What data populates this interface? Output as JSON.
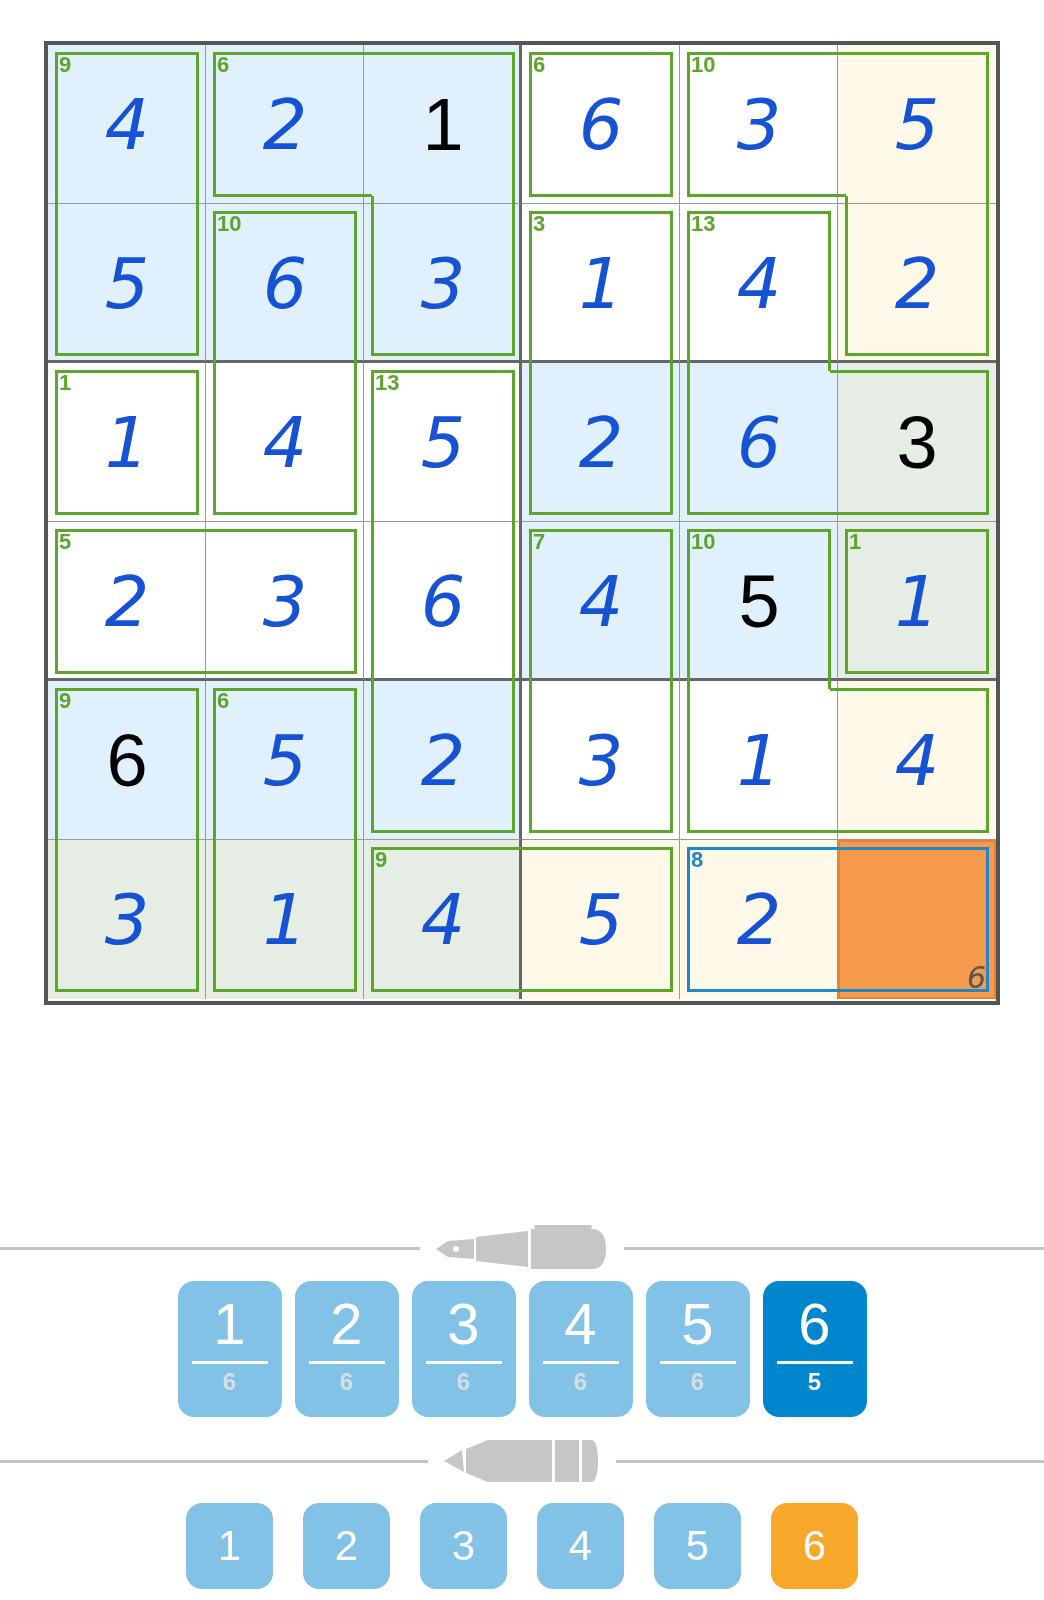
{
  "grid": {
    "rows": [
      [
        {
          "value": "4",
          "given": false,
          "color": "#e0f0fc",
          "sum": "9",
          "kind": "top",
          "selected": false,
          "cage_active": false
        },
        {
          "value": "2",
          "given": false,
          "color": "#e0f0fc",
          "sum": "6",
          "kind": "left",
          "selected": false,
          "cage_active": false
        },
        {
          "value": "1",
          "given": true,
          "color": "#e0f0fc",
          "kind": "topright",
          "selected": false,
          "cage_active": false
        },
        {
          "value": "6",
          "given": false,
          "color": "#ffffff",
          "sum": "6",
          "kind": "single",
          "selected": false,
          "cage_active": false
        },
        {
          "value": "3",
          "given": false,
          "color": "#ffffff",
          "sum": "10",
          "kind": "left",
          "selected": false,
          "cage_active": false
        },
        {
          "value": "5",
          "given": false,
          "color": "#fdf8e7",
          "kind": "topright",
          "selected": false,
          "cage_active": false
        }
      ],
      [
        {
          "value": "5",
          "given": false,
          "color": "#e0f0fc",
          "kind": "bottom",
          "selected": false,
          "cage_active": false
        },
        {
          "value": "6",
          "given": false,
          "color": "#e0f0fc",
          "sum": "10",
          "kind": "top",
          "selected": false,
          "cage_active": false
        },
        {
          "value": "3",
          "given": false,
          "color": "#e0f0fc",
          "kind": "bottom",
          "selected": false,
          "cage_active": false
        },
        {
          "value": "1",
          "given": false,
          "color": "#ffffff",
          "sum": "3",
          "kind": "top",
          "selected": false,
          "cage_active": false
        },
        {
          "value": "4",
          "given": false,
          "color": "#ffffff",
          "sum": "13",
          "kind": "top",
          "selected": false,
          "cage_active": false
        },
        {
          "value": "2",
          "given": false,
          "color": "#fdf8e7",
          "kind": "bottom",
          "selected": false,
          "cage_active": false
        }
      ],
      [
        {
          "value": "1",
          "given": false,
          "color": "#ffffff",
          "sum": "1",
          "kind": "single",
          "selected": false,
          "cage_active": false
        },
        {
          "value": "4",
          "given": false,
          "color": "#ffffff",
          "kind": "bottom",
          "selected": false,
          "cage_active": false
        },
        {
          "value": "5",
          "given": false,
          "color": "#ffffff",
          "sum": "13",
          "kind": "top",
          "selected": false,
          "cage_active": false
        },
        {
          "value": "2",
          "given": false,
          "color": "#e0f0fc",
          "kind": "bottom",
          "selected": false,
          "cage_active": false
        },
        {
          "value": "6",
          "given": false,
          "color": "#e0f0fc",
          "kind": "bottomleft",
          "selected": false,
          "cage_active": false
        },
        {
          "value": "3",
          "given": true,
          "color": "#e6ede4",
          "kind": "right",
          "selected": false,
          "cage_active": false
        }
      ],
      [
        {
          "value": "2",
          "given": false,
          "color": "#ffffff",
          "sum": "5",
          "kind": "left",
          "selected": false,
          "cage_active": false
        },
        {
          "value": "3",
          "given": false,
          "color": "#ffffff",
          "kind": "right",
          "selected": false,
          "cage_active": false
        },
        {
          "value": "6",
          "given": false,
          "color": "#ffffff",
          "kind": "middle",
          "selected": false,
          "cage_active": false
        },
        {
          "value": "4",
          "given": false,
          "color": "#e0f0fc",
          "sum": "7",
          "kind": "top",
          "selected": false,
          "cage_active": false
        },
        {
          "value": "5",
          "given": true,
          "color": "#e0f0fc",
          "sum": "10",
          "kind": "top",
          "selected": false,
          "cage_active": false
        },
        {
          "value": "1",
          "given": false,
          "color": "#e6ede4",
          "sum": "1",
          "kind": "single",
          "selected": false,
          "cage_active": false
        }
      ],
      [
        {
          "value": "6",
          "given": true,
          "color": "#e0f0fc",
          "sum": "9",
          "kind": "top",
          "selected": false,
          "cage_active": false
        },
        {
          "value": "5",
          "given": false,
          "color": "#e0f0fc",
          "sum": "6",
          "kind": "top",
          "selected": false,
          "cage_active": false
        },
        {
          "value": "2",
          "given": false,
          "color": "#e0f0fc",
          "kind": "bottom",
          "selected": false,
          "cage_active": false
        },
        {
          "value": "3",
          "given": false,
          "color": "#ffffff",
          "kind": "bottom",
          "selected": false,
          "cage_active": false
        },
        {
          "value": "1",
          "given": false,
          "color": "#ffffff",
          "kind": "bottomleft",
          "selected": false,
          "cage_active": false
        },
        {
          "value": "4",
          "given": false,
          "color": "#fdf8e7",
          "kind": "right",
          "selected": false,
          "cage_active": false
        }
      ],
      [
        {
          "value": "3",
          "given": false,
          "color": "#e6ede4",
          "kind": "bottom",
          "selected": false,
          "cage_active": false
        },
        {
          "value": "1",
          "given": false,
          "color": "#e6ede4",
          "kind": "bottom",
          "selected": false,
          "cage_active": false
        },
        {
          "value": "4",
          "given": false,
          "color": "#e6ede4",
          "sum": "9",
          "kind": "left",
          "selected": false,
          "cage_active": false
        },
        {
          "value": "5",
          "given": false,
          "color": "#fdf8e7",
          "kind": "right",
          "selected": false,
          "cage_active": false
        },
        {
          "value": "2",
          "given": false,
          "color": "#fdf8e7",
          "sum": "8",
          "kind": "left",
          "selected": false,
          "cage_active": true
        },
        {
          "notes": "6",
          "color": "#f79a4e",
          "kind": "right",
          "selected": true,
          "cage_active": true
        }
      ]
    ]
  },
  "pen_digits": [
    {
      "digit": "1",
      "remaining": "6",
      "selected": false
    },
    {
      "digit": "2",
      "remaining": "6",
      "selected": false
    },
    {
      "digit": "3",
      "remaining": "6",
      "selected": false
    },
    {
      "digit": "4",
      "remaining": "6",
      "selected": false
    },
    {
      "digit": "5",
      "remaining": "6",
      "selected": false
    },
    {
      "digit": "6",
      "remaining": "5",
      "selected": true
    }
  ],
  "pencil_digits": [
    {
      "digit": "1",
      "selected": false
    },
    {
      "digit": "2",
      "selected": false
    },
    {
      "digit": "3",
      "selected": false
    },
    {
      "digit": "4",
      "selected": false
    },
    {
      "digit": "5",
      "selected": false
    },
    {
      "digit": "6",
      "selected": true
    }
  ]
}
